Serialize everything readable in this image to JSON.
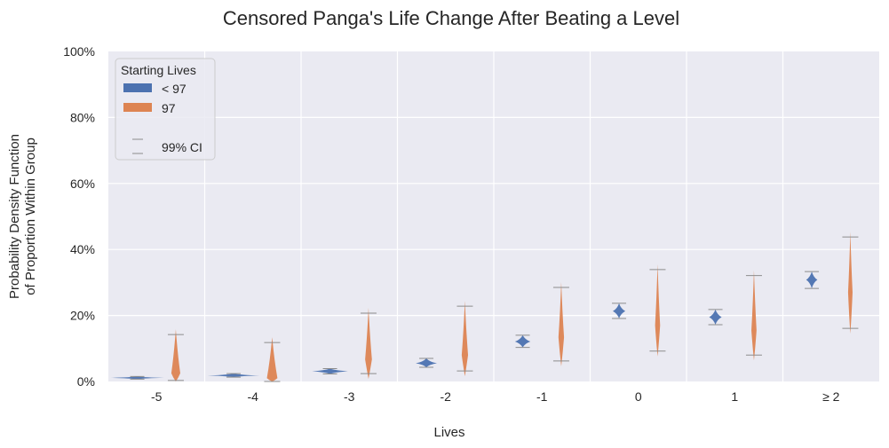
{
  "chart_data": {
    "type": "violin",
    "title": "Censored Panga's Life Change After Beating a Level",
    "xlabel": "Lives",
    "ylabel_lines": [
      "Probability Density Function",
      "of Proportion Within Group"
    ],
    "ylim": [
      0,
      100
    ],
    "yticks": [
      0,
      20,
      40,
      60,
      80,
      100
    ],
    "ytick_labels": [
      "0%",
      "20%",
      "40%",
      "60%",
      "80%",
      "100%"
    ],
    "grid": true,
    "categories": [
      "-5",
      "-4",
      "-3",
      "-2",
      "-1",
      "0",
      "1",
      "≥ 2"
    ],
    "legend": {
      "title": "Starting Lives",
      "placement": "top-left",
      "entries": [
        {
          "label": "< 97",
          "color": "#4c72b0"
        },
        {
          "label": "97",
          "color": "#dd8452"
        },
        {
          "label": "99% CI",
          "color": "#8c8c8c"
        }
      ]
    },
    "series": [
      {
        "name": "< 97",
        "color": "#4c72b0",
        "center": [
          1.1,
          1.8,
          3.1,
          5.5,
          12.1,
          21.3,
          19.5,
          30.8
        ],
        "ci_low": [
          0.7,
          1.3,
          2.3,
          4.3,
          10.3,
          19.1,
          17.2,
          28.2
        ],
        "ci_high": [
          1.5,
          2.4,
          3.9,
          7.0,
          14.0,
          23.7,
          21.8,
          33.3
        ]
      },
      {
        "name": "97",
        "color": "#dd8452",
        "center": [
          2.5,
          1.0,
          6.7,
          8.0,
          13.4,
          17.0,
          15.5,
          27.0
        ],
        "ci_low": [
          0.3,
          0.0,
          2.4,
          3.2,
          6.2,
          9.2,
          8.0,
          16.1
        ],
        "ci_high": [
          14.2,
          11.8,
          20.7,
          22.8,
          28.5,
          33.9,
          32.1,
          43.8
        ]
      }
    ]
  }
}
